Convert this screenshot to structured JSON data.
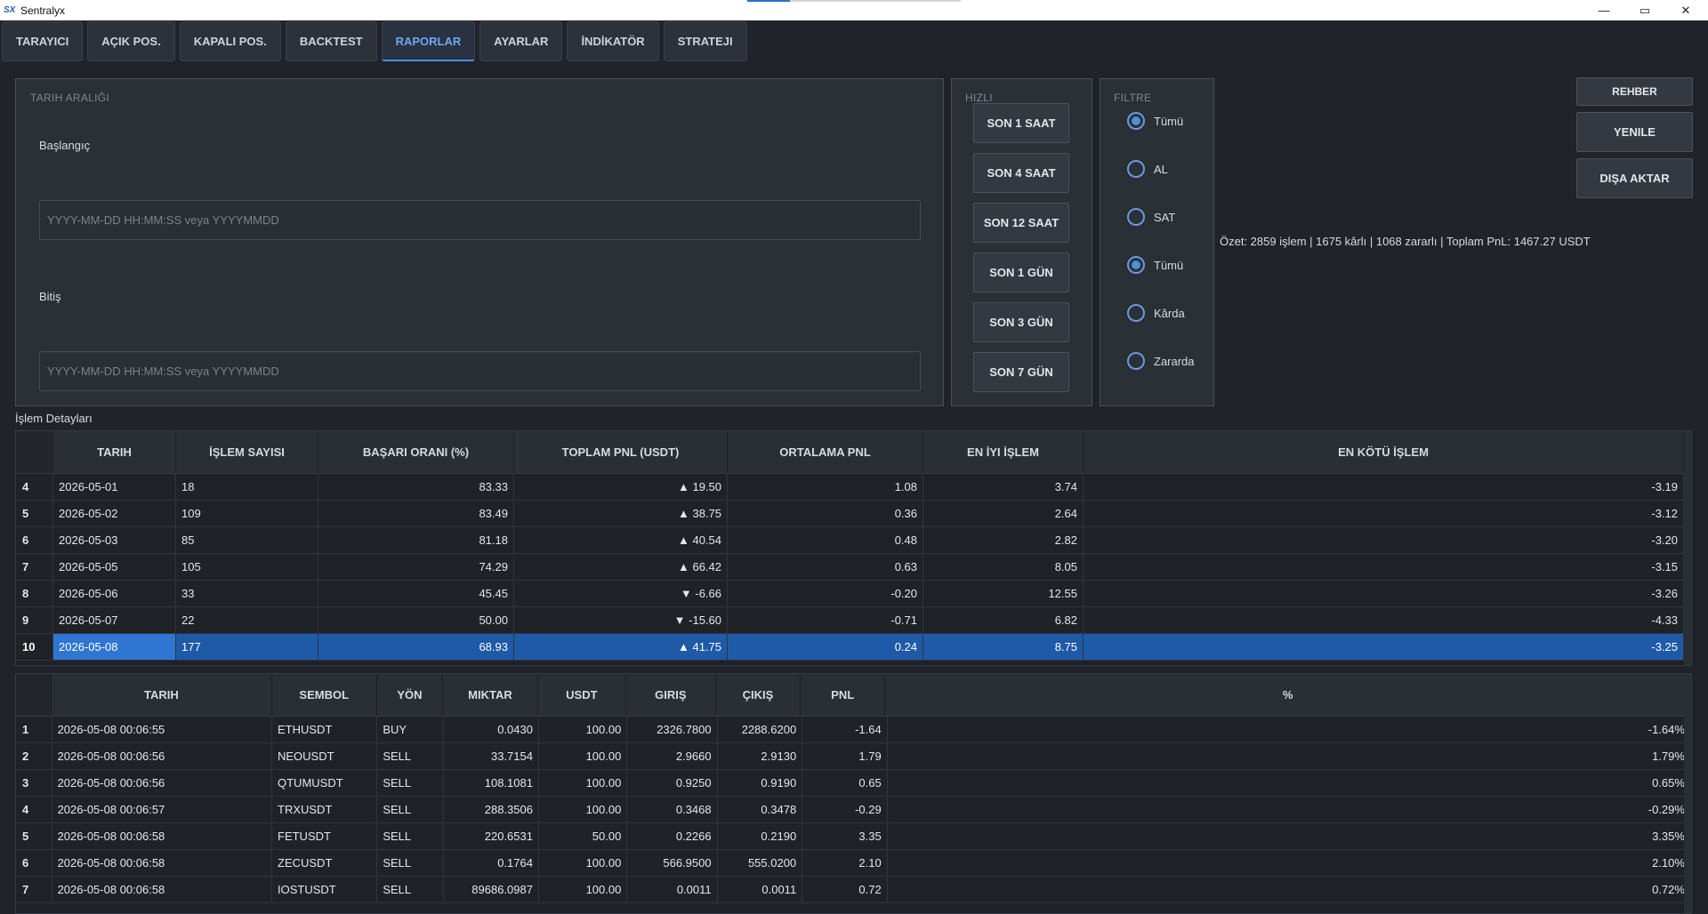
{
  "window": {
    "logo": "SX",
    "title": "Sentralyx",
    "minimize": "—",
    "maximize": "▭",
    "close": "✕"
  },
  "tabs": [
    "TARAYICI",
    "AÇIK POS.",
    "KAPALI POS.",
    "BACKTEST",
    "RAPORLAR",
    "AYARLAR",
    "İNDİKATÖR",
    "STRATEJI"
  ],
  "active_tab": "RAPORLAR",
  "date_range": {
    "title": "TARIH ARALIĞI",
    "start_label": "Başlangıç",
    "start_placeholder": "YYYY-MM-DD HH:MM:SS veya YYYYMMDD",
    "end_label": "Bitiş",
    "end_placeholder": "YYYY-MM-DD HH:MM:SS veya YYYYMMDD"
  },
  "quick": {
    "title": "HIZLI",
    "buttons": [
      "SON 1 SAAT",
      "SON 4 SAAT",
      "SON 12 SAAT",
      "SON 1 GÜN",
      "SON 3 GÜN",
      "SON 7 GÜN"
    ]
  },
  "filter": {
    "title": "FILTRE",
    "options": [
      {
        "label": "Tümü",
        "checked": true
      },
      {
        "label": "AL",
        "checked": false
      },
      {
        "label": "SAT",
        "checked": false
      },
      {
        "label": "Tümü",
        "checked": true
      },
      {
        "label": "Kârda",
        "checked": false
      },
      {
        "label": "Zararda",
        "checked": false
      }
    ]
  },
  "side_buttons": {
    "guide": "REHBER",
    "refresh": "YENILE",
    "export": "DIŞA AKTAR"
  },
  "summary": "Özet: 2859 işlem | 1675 kârlı | 1068 zararlı | Toplam PnL: 1467.27 USDT",
  "details_label": "İşlem Detayları",
  "daily_table": {
    "headers": [
      "TARIH",
      "İŞLEM SAYISI",
      "BAŞARI ORANI (%)",
      "TOPLAM PNL (USDT)",
      "ORTALAMA PNL",
      "EN İYI İŞLEM",
      "EN KÖTÜ İŞLEM"
    ],
    "rows": [
      {
        "idx": "4",
        "cells": [
          "2026-05-01",
          "18",
          "83.33",
          "▲ 19.50",
          "1.08",
          "3.74",
          "-3.19"
        ]
      },
      {
        "idx": "5",
        "cells": [
          "2026-05-02",
          "109",
          "83.49",
          "▲ 38.75",
          "0.36",
          "2.64",
          "-3.12"
        ]
      },
      {
        "idx": "6",
        "cells": [
          "2026-05-03",
          "85",
          "81.18",
          "▲ 40.54",
          "0.48",
          "2.82",
          "-3.20"
        ]
      },
      {
        "idx": "7",
        "cells": [
          "2026-05-05",
          "105",
          "74.29",
          "▲ 66.42",
          "0.63",
          "8.05",
          "-3.15"
        ]
      },
      {
        "idx": "8",
        "cells": [
          "2026-05-06",
          "33",
          "45.45",
          "▼ -6.66",
          "-0.20",
          "12.55",
          "-3.26"
        ]
      },
      {
        "idx": "9",
        "cells": [
          "2026-05-07",
          "22",
          "50.00",
          "▼ -15.60",
          "-0.71",
          "6.82",
          "-4.33"
        ]
      },
      {
        "idx": "10",
        "cells": [
          "2026-05-08",
          "177",
          "68.93",
          "▲ 41.75",
          "0.24",
          "8.75",
          "-3.25"
        ],
        "selected": true
      }
    ]
  },
  "trades_table": {
    "headers": [
      "TARIH",
      "SEMBOL",
      "YÖN",
      "MIKTAR",
      "USDT",
      "GIRIŞ",
      "ÇIKIŞ",
      "PNL",
      "%"
    ],
    "rows": [
      {
        "idx": "1",
        "cells": [
          "2026-05-08 00:06:55",
          "ETHUSDT",
          "BUY",
          "0.0430",
          "100.00",
          "2326.7800",
          "2288.6200",
          "-1.64",
          "-1.64%"
        ]
      },
      {
        "idx": "2",
        "cells": [
          "2026-05-08 00:06:56",
          "NEOUSDT",
          "SELL",
          "33.7154",
          "100.00",
          "2.9660",
          "2.9130",
          "1.79",
          "1.79%"
        ]
      },
      {
        "idx": "3",
        "cells": [
          "2026-05-08 00:06:56",
          "QTUMUSDT",
          "SELL",
          "108.1081",
          "100.00",
          "0.9250",
          "0.9190",
          "0.65",
          "0.65%"
        ]
      },
      {
        "idx": "4",
        "cells": [
          "2026-05-08 00:06:57",
          "TRXUSDT",
          "SELL",
          "288.3506",
          "100.00",
          "0.3468",
          "0.3478",
          "-0.29",
          "-0.29%"
        ]
      },
      {
        "idx": "5",
        "cells": [
          "2026-05-08 00:06:58",
          "FETUSDT",
          "SELL",
          "220.6531",
          "50.00",
          "0.2266",
          "0.2190",
          "3.35",
          "3.35%"
        ]
      },
      {
        "idx": "6",
        "cells": [
          "2026-05-08 00:06:58",
          "ZECUSDT",
          "SELL",
          "0.1764",
          "100.00",
          "566.9500",
          "555.0200",
          "2.10",
          "2.10%"
        ]
      },
      {
        "idx": "7",
        "cells": [
          "2026-05-08 00:06:58",
          "IOSTUSDT",
          "SELL",
          "89686.0987",
          "100.00",
          "0.0011",
          "0.0011",
          "0.72",
          "0.72%"
        ]
      }
    ]
  }
}
